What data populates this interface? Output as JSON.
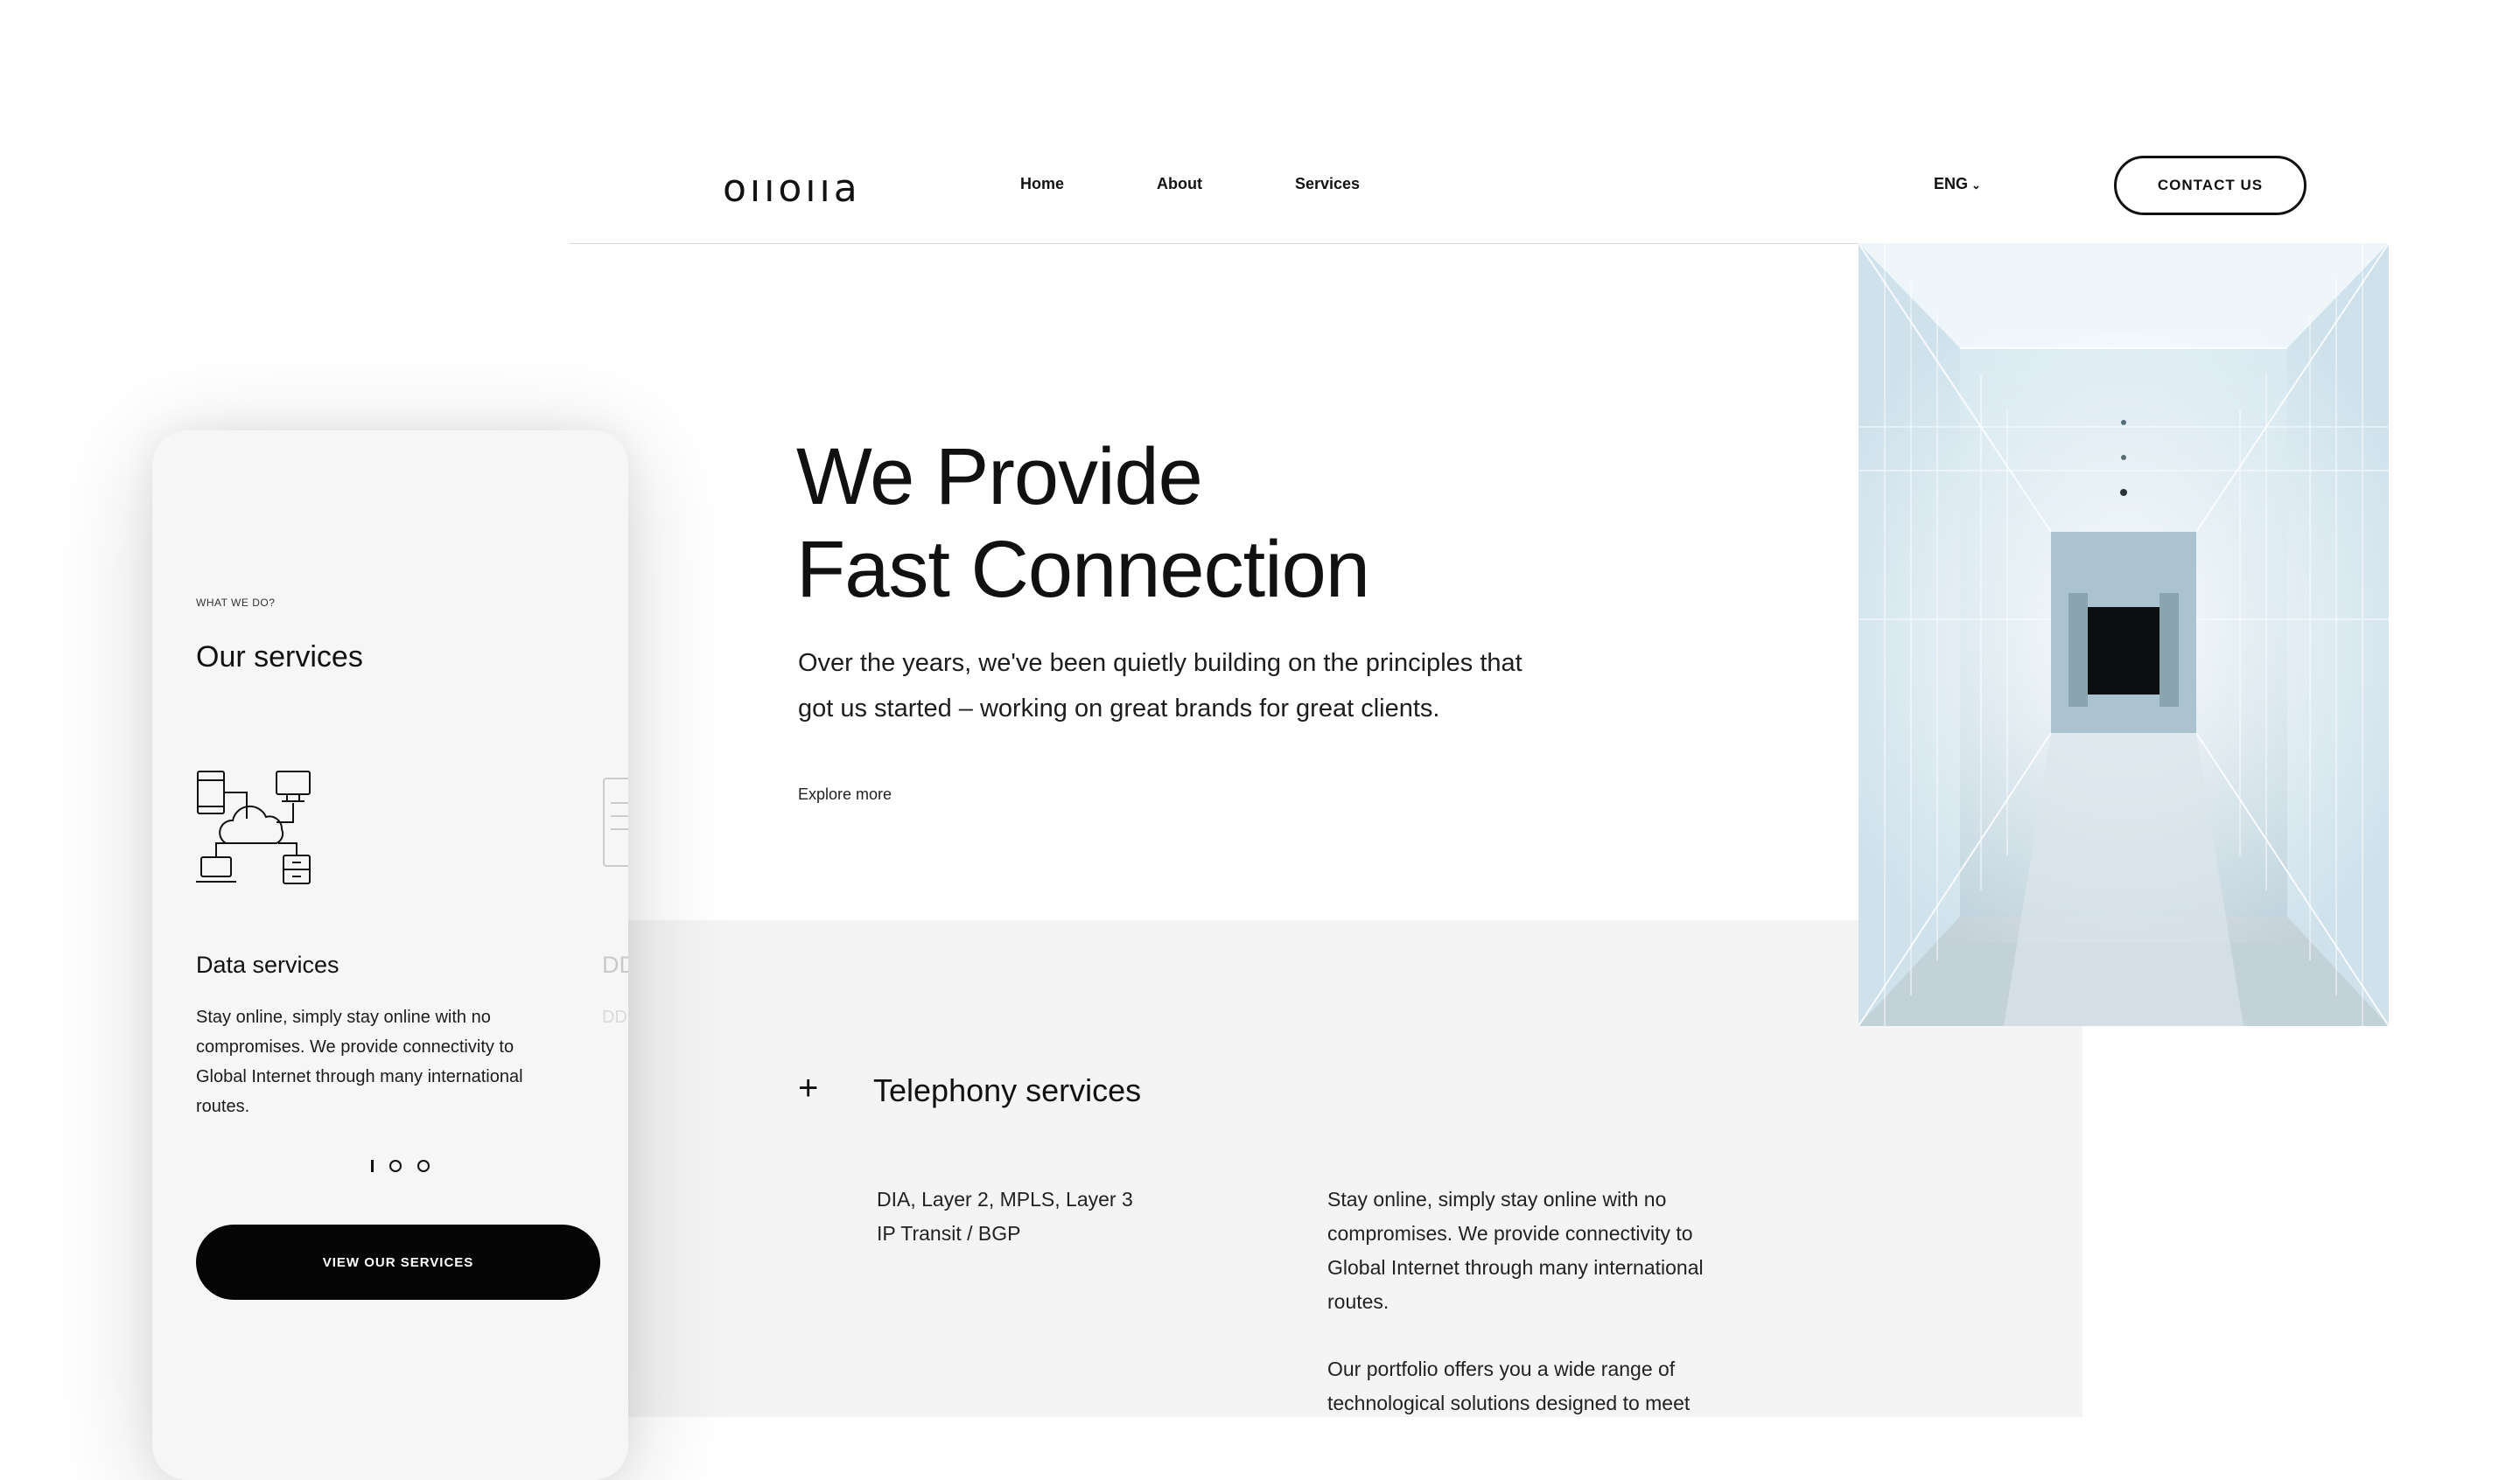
{
  "header": {
    "logo_text": "oııoııa",
    "nav": [
      "Home",
      "About",
      "Services"
    ],
    "language": "ENG",
    "contact_label": "CONTACT US"
  },
  "hero": {
    "title_line1": "We Provide",
    "title_line2": "Fast Connection",
    "text_line1": "Over the years, we've been quietly building on the principles that",
    "text_line2": "got us started – working on great brands for great clients.",
    "explore": "Explore more",
    "image": "glass-corridor-photo"
  },
  "services_section": {
    "expand_icon": "plus-icon",
    "title": "Telephony services",
    "tags": [
      "DIA, Layer 2, MPLS, Layer 3",
      "IP Transit / BGP"
    ],
    "desc_p1": "Stay online, simply stay online with no compromises. We provide connectivity to Global Internet through many international routes.",
    "desc_p2": "Our portfolio offers you a wide range of technological solutions designed to meet"
  },
  "mobile": {
    "eyebrow": "WHAT WE DO?",
    "title": "Our services",
    "card_icon": "cloud-network-icon",
    "card_title": "Data services",
    "card_text": "Stay online, simply stay online with no compromises. We provide connectivity to Global Internet through many international routes.",
    "next_card_title": "DD",
    "next_card_text": "DD sec pa",
    "pagination": {
      "total": 3,
      "active": 1
    },
    "button_label": "VIEW OUR SERVICES"
  },
  "colors": {
    "background": "#ffffff",
    "section_gray": "#f4f4f4",
    "text": "#111111",
    "button_dark": "#050505"
  }
}
